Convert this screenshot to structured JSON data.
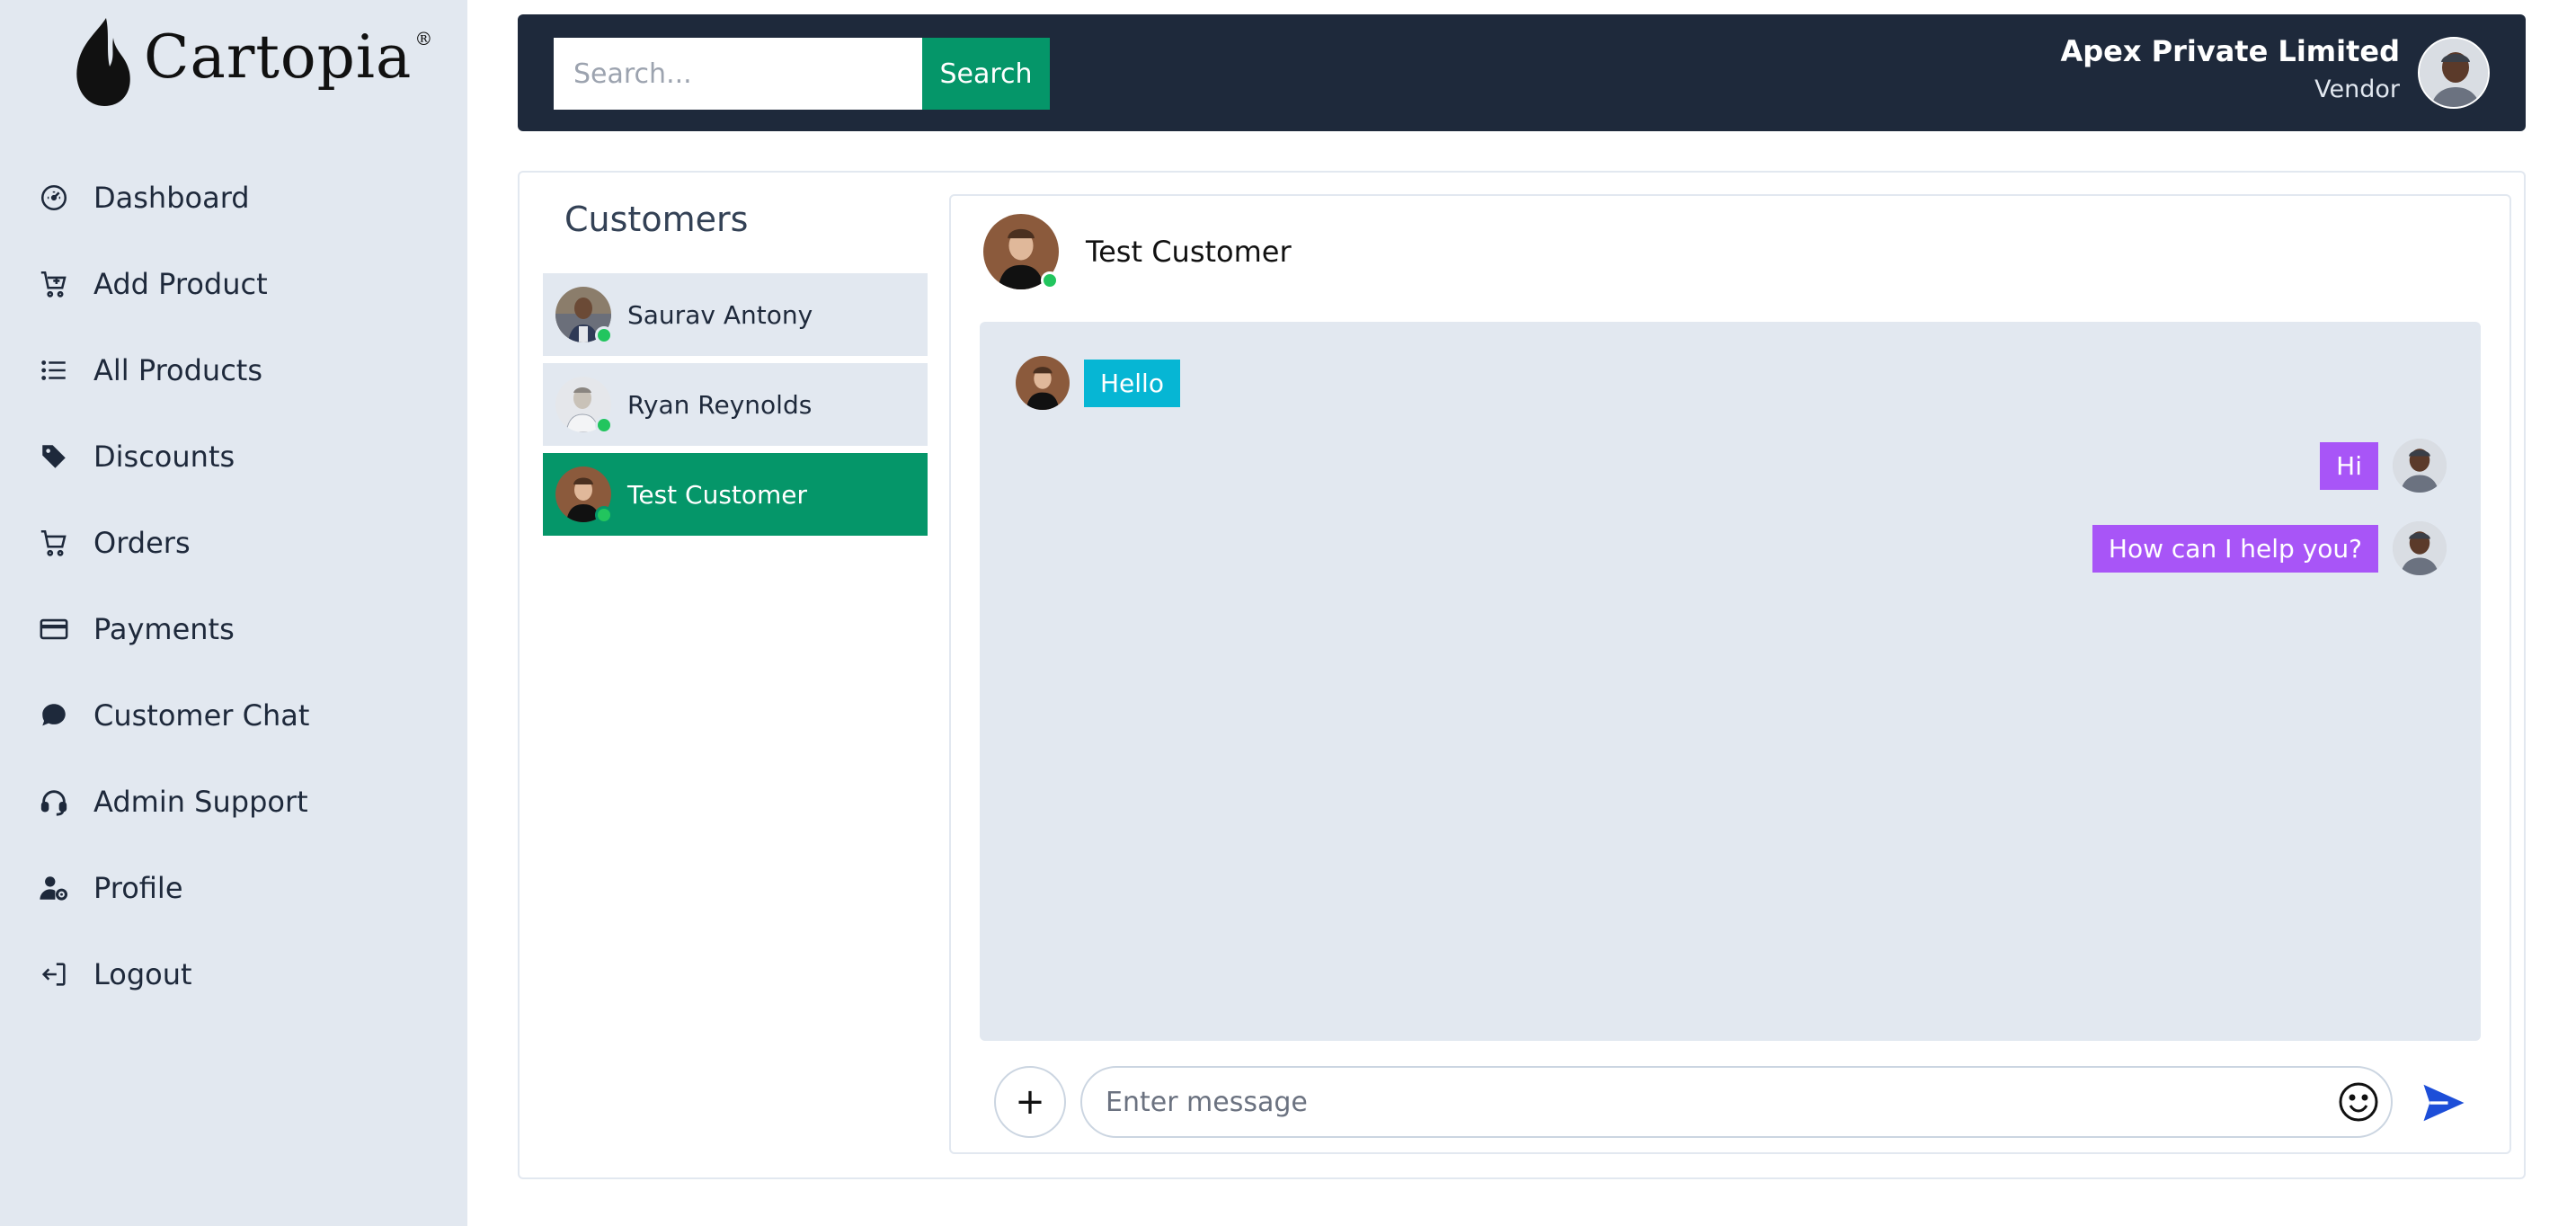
{
  "brand": {
    "name": "Cartopia",
    "reg": "®"
  },
  "sidebar": {
    "items": [
      {
        "label": "Dashboard",
        "icon": "gauge-icon"
      },
      {
        "label": "Add Product",
        "icon": "cart-plus-icon"
      },
      {
        "label": "All Products",
        "icon": "list-icon"
      },
      {
        "label": "Discounts",
        "icon": "tags-icon"
      },
      {
        "label": "Orders",
        "icon": "cart-icon"
      },
      {
        "label": "Payments",
        "icon": "credit-card-icon"
      },
      {
        "label": "Customer Chat",
        "icon": "chat-icon"
      },
      {
        "label": "Admin Support",
        "icon": "headset-icon"
      },
      {
        "label": "Profile",
        "icon": "user-gear-icon"
      },
      {
        "label": "Logout",
        "icon": "logout-icon"
      }
    ]
  },
  "topbar": {
    "search_placeholder": "Search...",
    "search_button": "Search",
    "vendor_name": "Apex Private Limited",
    "vendor_role": "Vendor"
  },
  "customers": {
    "title": "Customers",
    "list": [
      {
        "name": "Saurav Antony",
        "online": true,
        "active": false
      },
      {
        "name": "Ryan Reynolds",
        "online": true,
        "active": false
      },
      {
        "name": "Test Customer",
        "online": true,
        "active": true
      }
    ]
  },
  "chat": {
    "header_name": "Test Customer",
    "messages": [
      {
        "text": "Hello",
        "direction": "in"
      },
      {
        "text": "Hi",
        "direction": "out"
      },
      {
        "text": "How can I help you?",
        "direction": "out"
      }
    ],
    "input_placeholder": "Enter message",
    "plus_label": "+"
  },
  "colors": {
    "sidebar_bg": "#e2e8f0",
    "topbar_bg": "#1e293b",
    "accent_green": "#059669",
    "incoming_bubble": "#06b6d4",
    "outgoing_bubble": "#a855f7",
    "online": "#22c55e",
    "send": "#1d4ed8"
  }
}
